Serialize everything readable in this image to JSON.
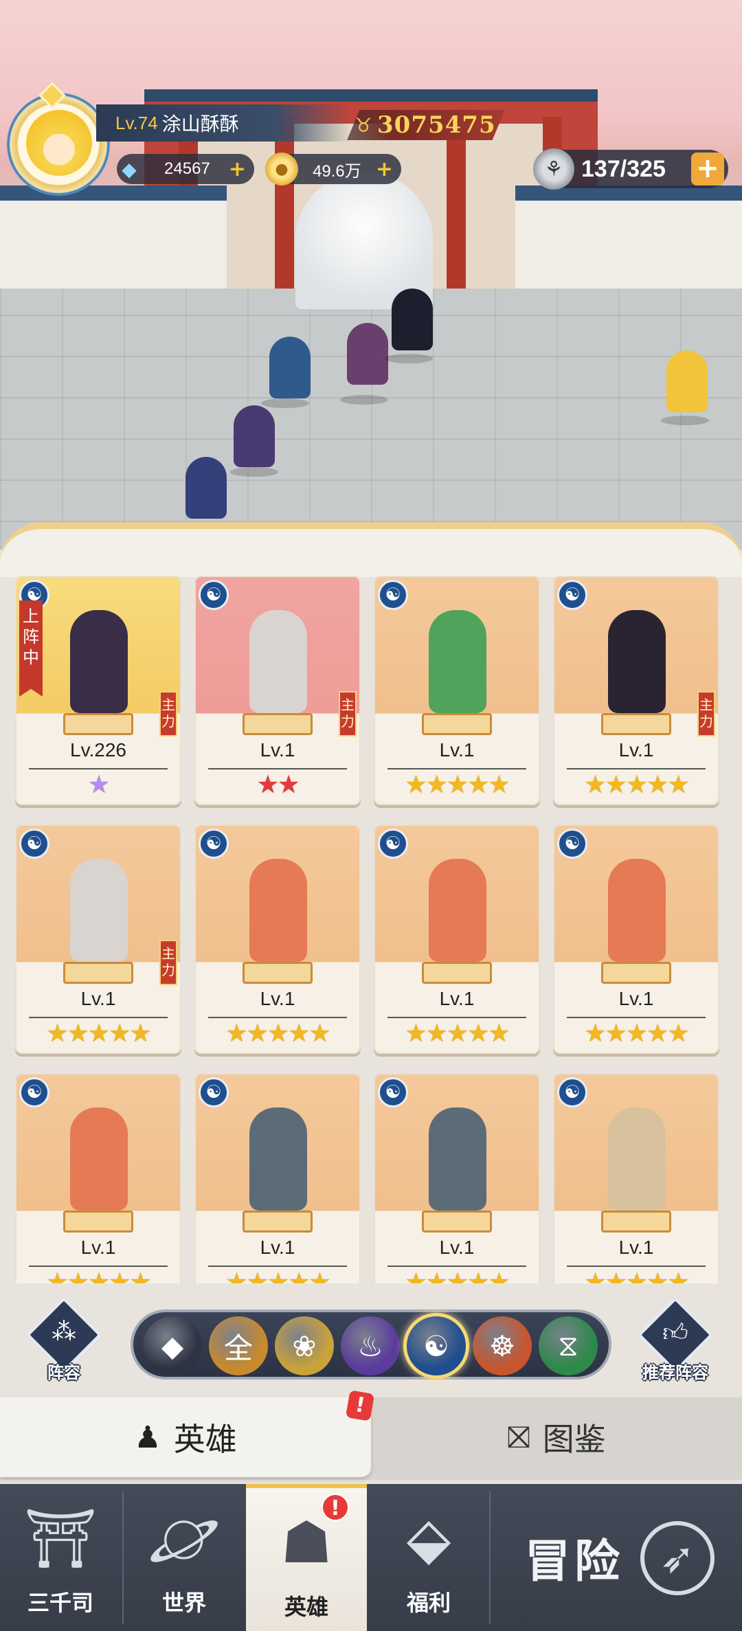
{
  "player": {
    "level": "Lv.74",
    "name": "涂山酥酥",
    "power": "3075475"
  },
  "resources": {
    "gems": "24567",
    "gold": "49.6万",
    "stamina": "137/325",
    "plus": "+"
  },
  "heroes": [
    {
      "level": "Lv.226",
      "stars": "★",
      "star_color": "purple",
      "tag_deployed": "上阵中",
      "tag_main": "主力",
      "card_color": "yellow"
    },
    {
      "level": "Lv.1",
      "stars": "★★",
      "star_color": "red",
      "tag_main": "主力",
      "card_color": "pink"
    },
    {
      "level": "Lv.1",
      "stars": "★★★★★",
      "star_color": "gold",
      "card_color": "orange"
    },
    {
      "level": "Lv.1",
      "stars": "★★★★★",
      "star_color": "gold",
      "tag_main": "主力",
      "card_color": "orange"
    },
    {
      "level": "Lv.1",
      "stars": "★★★★★",
      "star_color": "gold",
      "tag_main": "主力",
      "card_color": "orange"
    },
    {
      "level": "Lv.1",
      "stars": "★★★★★",
      "star_color": "gold",
      "card_color": "orange"
    },
    {
      "level": "Lv.1",
      "stars": "★★★★★",
      "star_color": "gold",
      "card_color": "orange"
    },
    {
      "level": "Lv.1",
      "stars": "★★★★★",
      "star_color": "gold",
      "card_color": "orange"
    },
    {
      "level": "Lv.1",
      "stars": "★★★★★",
      "star_color": "gold",
      "card_color": "orange"
    },
    {
      "level": "Lv.1",
      "stars": "★★★★★",
      "star_color": "gold",
      "card_color": "orange"
    },
    {
      "level": "Lv.1",
      "stars": "★★★★★",
      "star_color": "gold",
      "card_color": "orange"
    },
    {
      "level": "Lv.1",
      "stars": "★★★★★",
      "star_color": "gold",
      "card_color": "orange"
    }
  ],
  "filters": [
    {
      "icon": "tank-class-icon",
      "glyph": "◆",
      "color": "#2d3342"
    },
    {
      "icon": "all-icon",
      "glyph": "全",
      "color": "#c98a2e"
    },
    {
      "icon": "lotus-icon",
      "glyph": "❀",
      "color": "#c9a23a"
    },
    {
      "icon": "fire-icon",
      "glyph": "♨",
      "color": "#5b3b9c"
    },
    {
      "icon": "yinyang-icon",
      "glyph": "☯",
      "color": "#1f4f8e",
      "selected": true
    },
    {
      "icon": "meditate-icon",
      "glyph": "☸",
      "color": "#c9552e"
    },
    {
      "icon": "dna-icon",
      "glyph": "⧖",
      "color": "#2c8a4a"
    }
  ],
  "side_buttons": {
    "lineup": "阵容",
    "recommend": "推荐阵容"
  },
  "tabs": {
    "heroes": "英雄",
    "codex": "图鉴",
    "alert": "!"
  },
  "nav": {
    "sanqiansi": "三千司",
    "world": "世界",
    "heroes": "英雄",
    "welfare": "福利",
    "adventure": "冒险",
    "alert": "!"
  },
  "colors": {
    "accent_gold": "#f4c531",
    "nav_bg": "#3d4350",
    "alert_red": "#e63a38"
  }
}
